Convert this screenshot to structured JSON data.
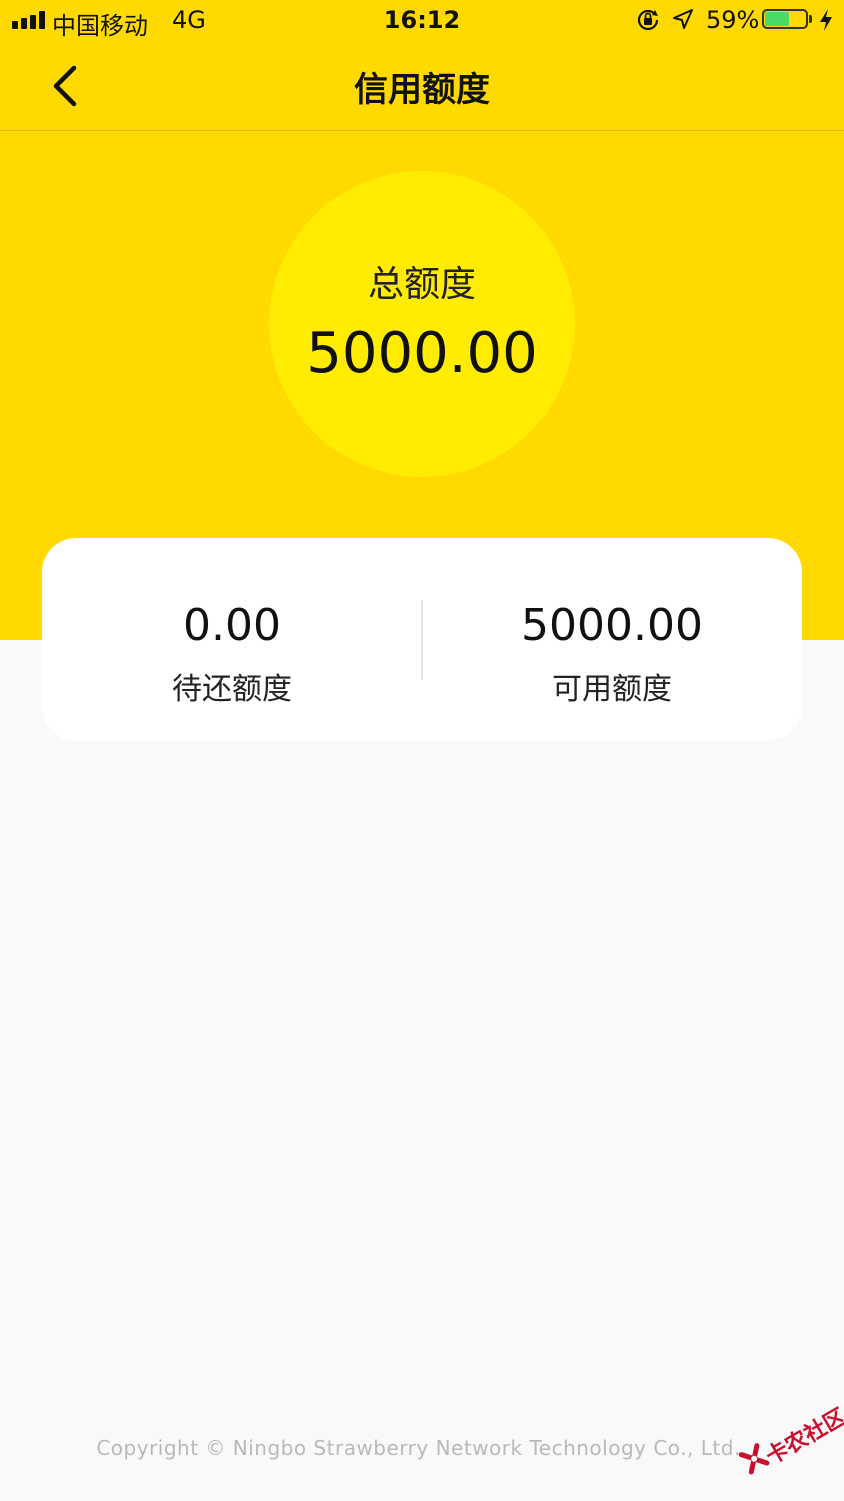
{
  "status_bar": {
    "carrier": "中国移动",
    "network": "4G",
    "time": "16:12",
    "battery_percent": "59%",
    "battery_level": 0.59,
    "icons": [
      "signal-icon",
      "orientation-lock-icon",
      "location-icon",
      "battery-icon",
      "charging-icon"
    ]
  },
  "nav": {
    "title": "信用额度",
    "back_icon": "chevron-left-icon"
  },
  "total": {
    "label": "总额度",
    "value": "5000.00"
  },
  "limits": [
    {
      "value": "0.00",
      "label": "待还额度"
    },
    {
      "value": "5000.00",
      "label": "可用额度"
    }
  ],
  "footer": {
    "copyright": "Copyright © Ningbo Strawberry Network Technology Co., Ltd.,"
  },
  "watermark": {
    "text": "卡农社区"
  },
  "colors": {
    "header_yellow": "#ffd900",
    "circle_yellow": "#ffec00",
    "page_background": "#f9f9f9",
    "card_background": "#ffffff",
    "battery_green": "#4cd964",
    "watermark_red": "#c8102e"
  }
}
